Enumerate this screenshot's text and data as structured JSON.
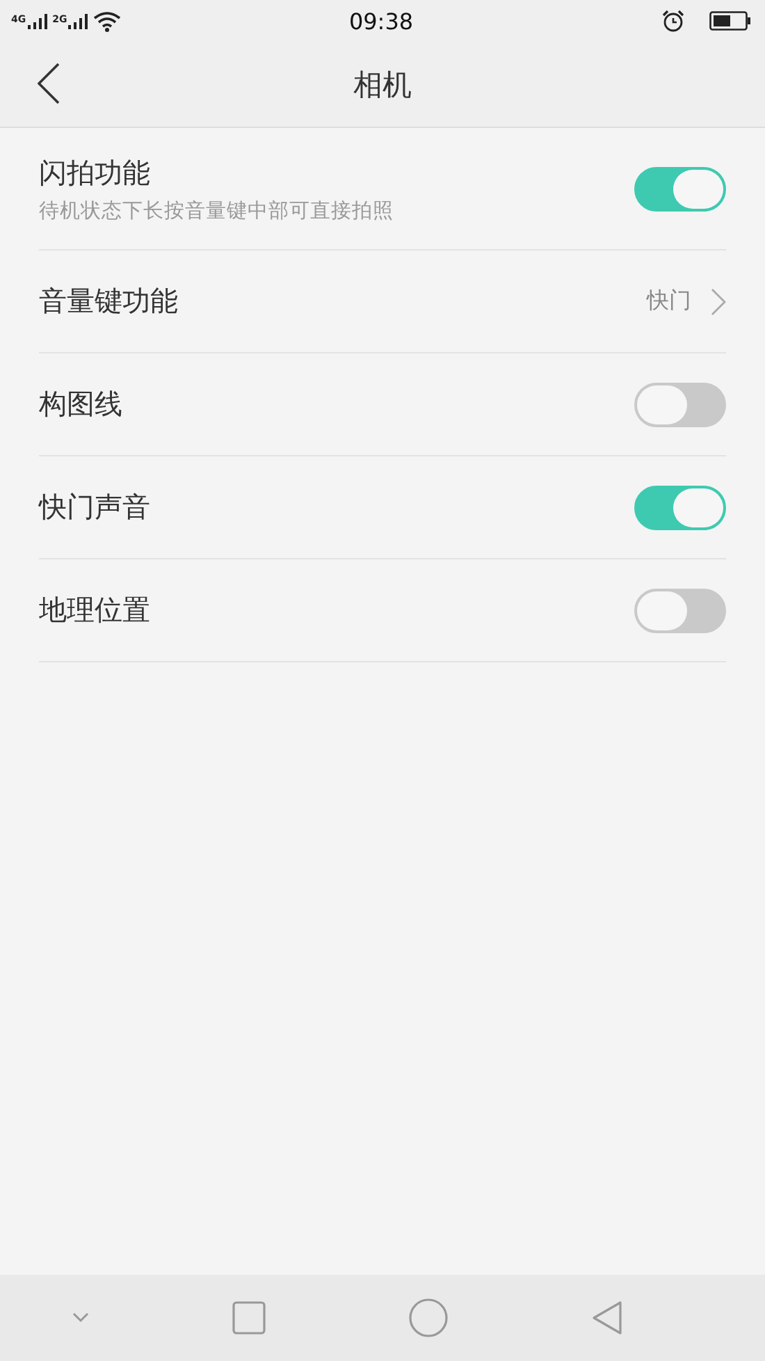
{
  "status_bar": {
    "network_1": "4G",
    "network_2": "2G",
    "time": "09:38"
  },
  "header": {
    "title": "相机"
  },
  "settings": [
    {
      "kind": "toggle",
      "label": "闪拍功能",
      "description": "待机状态下长按音量键中部可直接拍照",
      "on": true
    },
    {
      "kind": "link",
      "label": "音量键功能",
      "value": "快门"
    },
    {
      "kind": "toggle",
      "label": "构图线",
      "on": false
    },
    {
      "kind": "toggle",
      "label": "快门声音",
      "on": true
    },
    {
      "kind": "toggle",
      "label": "地理位置",
      "on": false
    }
  ]
}
